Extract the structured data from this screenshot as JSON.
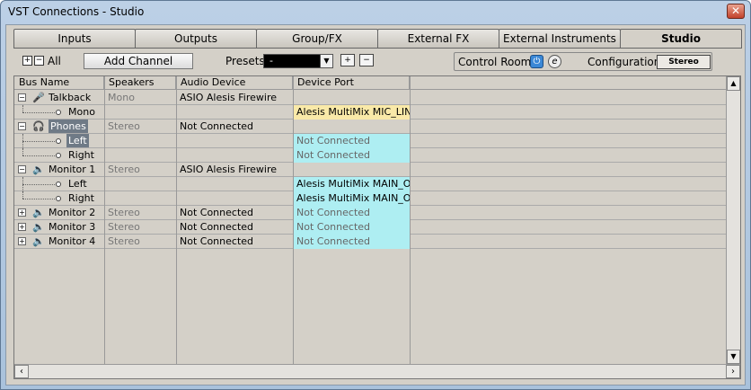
{
  "window": {
    "title": "VST Connections - Studio",
    "close_glyph": "✕"
  },
  "tabs": [
    {
      "label": "Inputs",
      "active": false
    },
    {
      "label": "Outputs",
      "active": false
    },
    {
      "label": "Group/FX",
      "active": false
    },
    {
      "label": "External FX",
      "active": false
    },
    {
      "label": "External Instruments",
      "active": false
    },
    {
      "label": "Studio",
      "active": true
    }
  ],
  "toolbar": {
    "all_label": "All",
    "add_channel_label": "Add Channel",
    "presets_label": "Presets",
    "presets_value": "-",
    "control_room_label": "Control Room:",
    "configuration_label": "Configuration:",
    "configuration_value": "Stereo"
  },
  "columns": [
    "Bus Name",
    "Speakers",
    "Audio Device",
    "Device Port"
  ],
  "rows": [
    {
      "name": "Talkback",
      "speakers": "Mono",
      "device": "ASIO Alesis Firewire",
      "port": "",
      "level": 0,
      "icon": "microphone-icon",
      "expanded": true
    },
    {
      "name": "Mono",
      "speakers": "",
      "device": "",
      "port": "Alesis MultiMix MIC_LINE",
      "level": 1,
      "port_style": "yellow"
    },
    {
      "name": "Phones",
      "speakers": "Stereo",
      "device": "Not Connected",
      "port": "",
      "level": 0,
      "icon": "headphones-icon",
      "expanded": true,
      "selected": true
    },
    {
      "name": "Left",
      "speakers": "",
      "device": "",
      "port": "Not Connected",
      "level": 1,
      "port_style": "cyan-grey",
      "selected": true
    },
    {
      "name": "Right",
      "speakers": "",
      "device": "",
      "port": "Not Connected",
      "level": 1,
      "port_style": "cyan-grey"
    },
    {
      "name": "Monitor 1",
      "speakers": "Stereo",
      "device": "ASIO Alesis Firewire",
      "port": "",
      "level": 0,
      "icon": "speaker-icon",
      "expanded": true
    },
    {
      "name": "Left",
      "speakers": "",
      "device": "",
      "port": "Alesis MultiMix MAIN_OUT",
      "level": 1,
      "port_style": "cyan"
    },
    {
      "name": "Right",
      "speakers": "",
      "device": "",
      "port": "Alesis MultiMix MAIN_OUT",
      "level": 1,
      "port_style": "cyan"
    },
    {
      "name": "Monitor 2",
      "speakers": "Stereo",
      "device": "Not Connected",
      "port": "Not Connected",
      "level": 0,
      "icon": "speaker-icon",
      "expanded": false,
      "port_style": "cyan-grey"
    },
    {
      "name": "Monitor 3",
      "speakers": "Stereo",
      "device": "Not Connected",
      "port": "Not Connected",
      "level": 0,
      "icon": "speaker-icon",
      "expanded": false,
      "port_style": "cyan-grey"
    },
    {
      "name": "Monitor 4",
      "speakers": "Stereo",
      "device": "Not Connected",
      "port": "Not Connected",
      "level": 0,
      "icon": "speaker-icon",
      "expanded": false,
      "port_style": "cyan-grey"
    }
  ]
}
